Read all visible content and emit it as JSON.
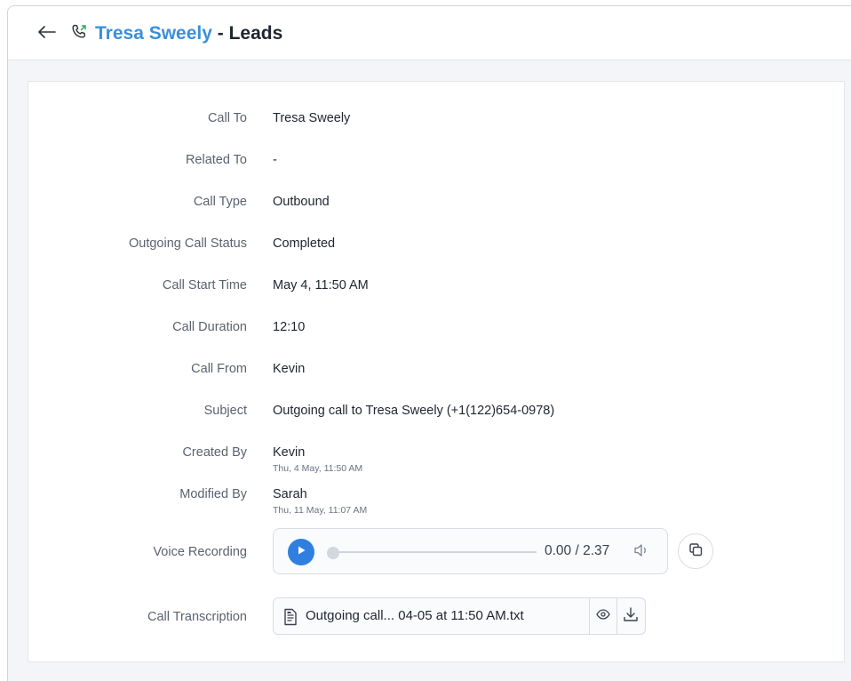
{
  "header": {
    "lead_name": "Tresa Sweely",
    "separator": " - ",
    "module": "Leads"
  },
  "fields": [
    {
      "label": "Call To",
      "value": "Tresa Sweely"
    },
    {
      "label": "Related To",
      "value": "-"
    },
    {
      "label": "Call Type",
      "value": "Outbound"
    },
    {
      "label": "Outgoing Call Status",
      "value": "Completed"
    },
    {
      "label": "Call Start Time",
      "value": "May 4, 11:50 AM"
    },
    {
      "label": "Call Duration",
      "value": "12:10"
    },
    {
      "label": "Call From",
      "value": "Kevin"
    },
    {
      "label": "Subject",
      "value": "Outgoing call to Tresa Sweely (+1(122)654-0978)"
    },
    {
      "label": "Created By",
      "value": "Kevin",
      "sub": "Thu, 4 May, 11:50 AM"
    },
    {
      "label": "Modified By",
      "value": "Sarah",
      "sub": "Thu, 11 May, 11:07 AM"
    }
  ],
  "voice_recording": {
    "label": "Voice Recording",
    "time": "0.00 / 2.37",
    "progress": 0
  },
  "call_transcription": {
    "label": "Call Transcription",
    "file_name": "Outgoing call... 04-05 at 11:50 AM.txt"
  },
  "colors": {
    "accent": "#3b8fd9",
    "play_button": "#2f7fe0",
    "call_icon_arrow": "#2eaa5c"
  },
  "icons": {
    "back": "arrow-left-icon",
    "call": "outgoing-call-icon",
    "play": "play-icon",
    "volume": "volume-icon",
    "copy": "copy-icon",
    "file": "text-file-icon",
    "preview": "eye-icon",
    "download": "download-icon"
  }
}
